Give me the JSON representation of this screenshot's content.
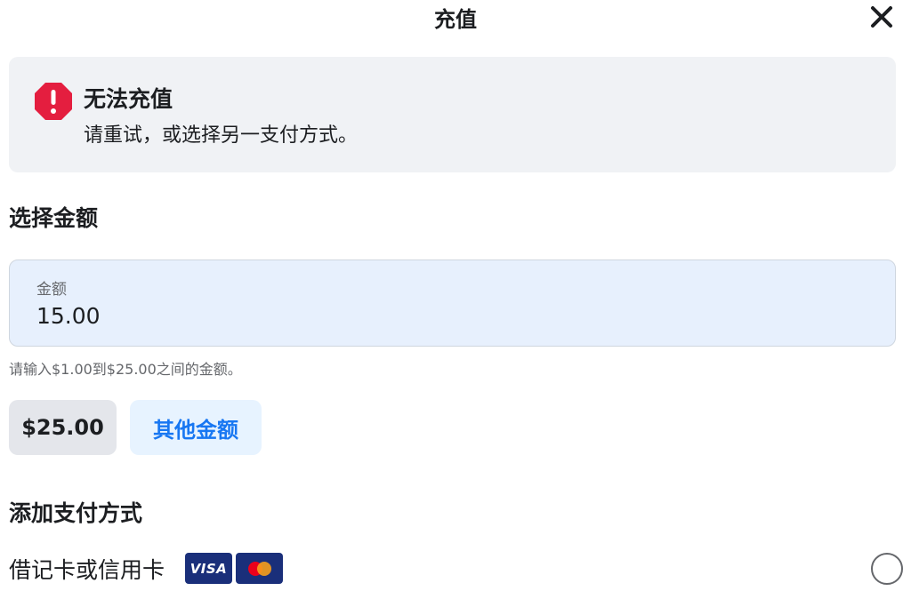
{
  "dialog": {
    "title": "充值",
    "close_icon": "close-icon"
  },
  "error": {
    "icon": "alert-octagon-icon",
    "title": "无法充值",
    "message": "请重试，或选择另一支付方式。",
    "color": "#e41e3f"
  },
  "amount_section": {
    "title": "选择金额",
    "field": {
      "label": "金额",
      "value": "15.00"
    },
    "helper": "请输入$1.00到$25.00之间的金额。",
    "options": [
      {
        "label": "$25.00"
      },
      {
        "label": "其他金额"
      }
    ]
  },
  "payment_section": {
    "title": "添加支付方式",
    "methods": [
      {
        "label": "借记卡或信用卡",
        "logos": [
          {
            "name": "visa-logo",
            "text": "VISA"
          },
          {
            "name": "mastercard-logo"
          }
        ],
        "selected": false
      }
    ]
  },
  "colors": {
    "accent": "#1877f2",
    "field_bg": "#e7f0fd",
    "banner_bg": "#f0f2f5"
  }
}
